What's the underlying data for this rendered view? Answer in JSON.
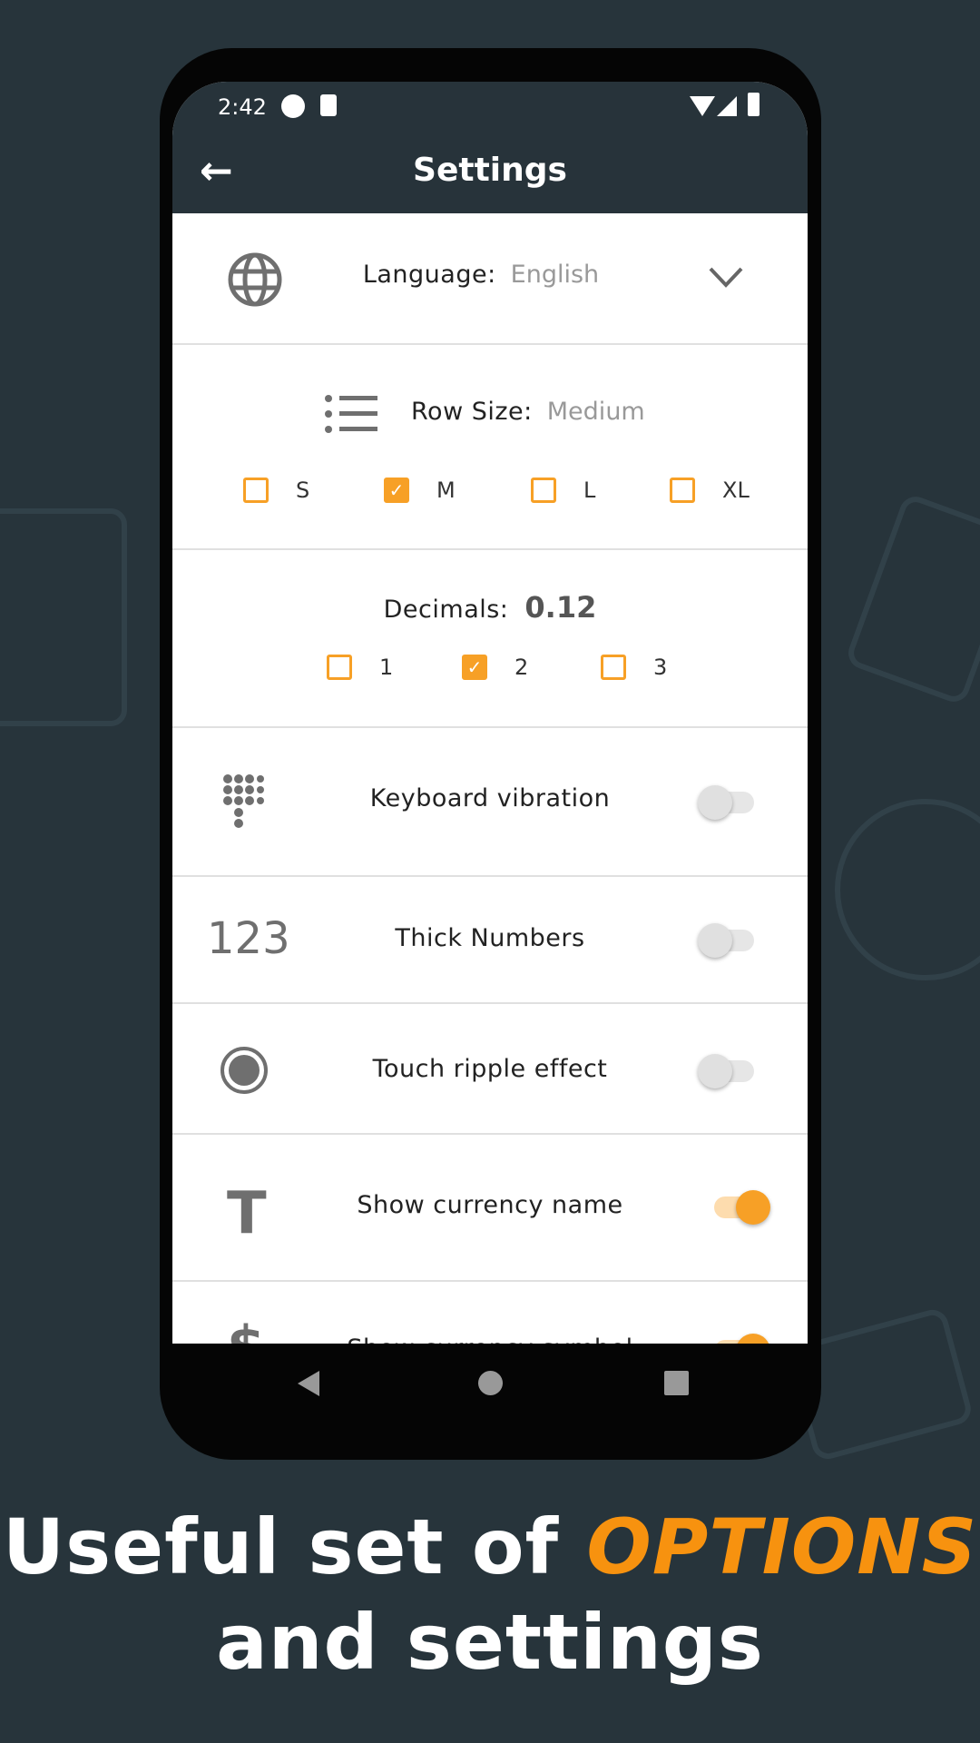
{
  "status_bar": {
    "time": "2:42"
  },
  "header": {
    "title": "Settings",
    "back_icon": "arrow-left-icon"
  },
  "language": {
    "label": "Language:",
    "value": "English"
  },
  "row_size": {
    "label": "Row Size:",
    "value": "Medium",
    "options": [
      {
        "label": "S",
        "checked": false
      },
      {
        "label": "M",
        "checked": true
      },
      {
        "label": "L",
        "checked": false
      },
      {
        "label": "XL",
        "checked": false
      }
    ]
  },
  "decimals": {
    "label": "Decimals:",
    "value": "0.12",
    "options": [
      {
        "label": "1",
        "checked": false
      },
      {
        "label": "2",
        "checked": true
      },
      {
        "label": "3",
        "checked": false
      }
    ]
  },
  "toggles": [
    {
      "label": "Keyboard vibration",
      "on": false,
      "icon": "keypad-icon"
    },
    {
      "label": "Thick Numbers",
      "on": false,
      "icon": "123",
      "icon_text": "123"
    },
    {
      "label": "Touch ripple effect",
      "on": false,
      "icon": "radio-icon"
    },
    {
      "label": "Show currency name",
      "on": true,
      "icon": "text-t-icon",
      "icon_text": "T"
    },
    {
      "label": "Show currency symbol",
      "on": true,
      "icon": "dollar-icon",
      "icon_text": "$"
    }
  ],
  "caption": {
    "line1_prefix": "Useful set of ",
    "line1_accent": "OPTIONS",
    "line2": "and settings"
  },
  "colors": {
    "accent": "#f7a026",
    "appbar": "#27333a",
    "background": "#27343b"
  }
}
